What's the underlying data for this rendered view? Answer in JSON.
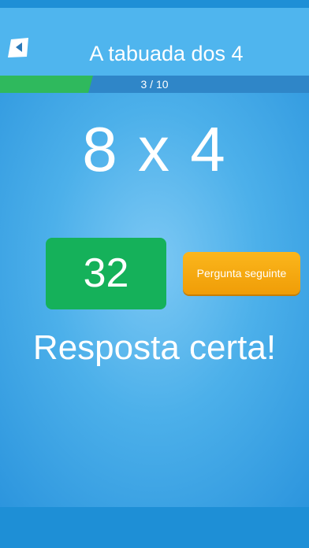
{
  "header": {
    "title": "A tabuada dos 4",
    "back_icon": "back-arrow-icon"
  },
  "progress": {
    "current": 3,
    "total": 10,
    "label": "3 / 10",
    "fill_fraction": 0.3
  },
  "question": {
    "text": "8 x 4"
  },
  "answer": {
    "value": "32"
  },
  "next_button": {
    "label": "Pergunta seguinte"
  },
  "feedback": {
    "text": "Resposta certa!"
  },
  "colors": {
    "header": "#4fb5ee",
    "progress_fill": "#2fb95d",
    "progress_track": "#2f86c8",
    "answer_correct": "#15b15a",
    "next_button": "#f6a60f"
  }
}
